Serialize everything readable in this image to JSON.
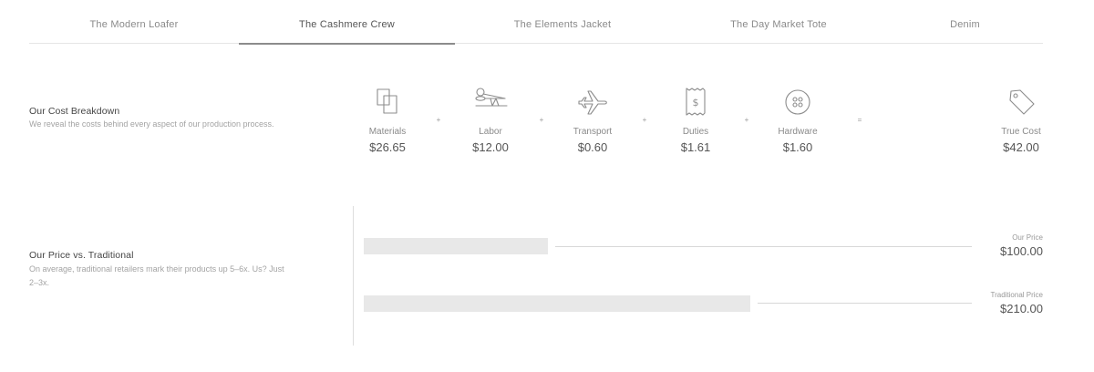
{
  "tabs": [
    {
      "label": "The Modern Loafer"
    },
    {
      "label": "The Cashmere Crew"
    },
    {
      "label": "The Elements Jacket"
    },
    {
      "label": "The Day Market Tote"
    },
    {
      "label": "Denim"
    }
  ],
  "active_tab": "The Cashmere Crew",
  "cost_breakdown": {
    "title": "Our Cost Breakdown",
    "description": "We reveal the costs behind every aspect of our production process.",
    "items": [
      {
        "label": "Materials",
        "amount": "$26.65",
        "icon": "materials-icon"
      },
      {
        "label": "Labor",
        "amount": "$12.00",
        "icon": "scissors-icon"
      },
      {
        "label": "Transport",
        "amount": "$0.60",
        "icon": "airplane-icon"
      },
      {
        "label": "Duties",
        "amount": "$1.61",
        "icon": "receipt-icon"
      },
      {
        "label": "Hardware",
        "amount": "$1.60",
        "icon": "button-icon"
      }
    ],
    "operators": [
      "+",
      "+",
      "+",
      "+",
      "="
    ],
    "total": {
      "label": "True Cost",
      "amount": "$42.00",
      "icon": "price-tag-icon"
    }
  },
  "price_comparison": {
    "title": "Our Price vs. Traditional",
    "description": "On average, traditional retailers mark their products up 5–6x. Us? Just 2–3x.",
    "our_price": {
      "label": "Our Price",
      "value": "$100.00",
      "amount": 100
    },
    "traditional_price": {
      "label": "Traditional Price",
      "value": "$210.00",
      "amount": 210
    }
  }
}
